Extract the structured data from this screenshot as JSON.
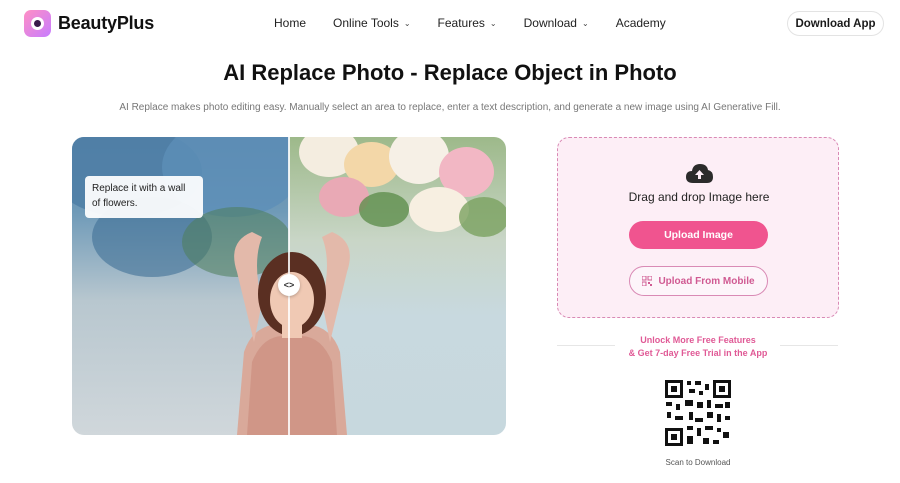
{
  "brand": {
    "name": "BeautyPlus",
    "accent": "#f0548f",
    "upload_bg": "#fdeef6"
  },
  "nav": {
    "items": [
      {
        "label": "Home",
        "has_dropdown": false
      },
      {
        "label": "Online Tools",
        "has_dropdown": true
      },
      {
        "label": "Features",
        "has_dropdown": true
      },
      {
        "label": "Download",
        "has_dropdown": true
      },
      {
        "label": "Academy",
        "has_dropdown": false
      }
    ],
    "cta": "Download App"
  },
  "main": {
    "title": "AI Replace Photo - Replace Object in Photo",
    "subtitle": "AI Replace makes photo editing easy. Manually select an area to replace, enter a text description, and generate a new image using AI Generative Fill.",
    "demo": {
      "prompt_text": "Replace it with a wall of flowers.",
      "handle_glyph": "<>"
    }
  },
  "upload": {
    "icon": "cloud-upload-icon",
    "drag_text": "Drag and drop Image here",
    "upload_button": "Upload Image",
    "mobile_button": "Upload From Mobile",
    "promo_line1": "Unlock More Free Features",
    "promo_line2": "& Get 7-day Free Trial in the App",
    "qr_caption": "Scan to Download"
  }
}
